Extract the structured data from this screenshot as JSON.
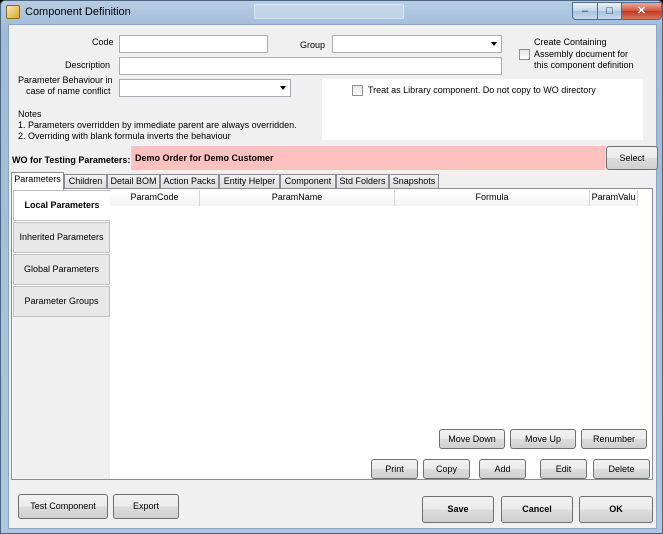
{
  "window": {
    "title": "Component Definition",
    "min_glyph": "–",
    "max_glyph": "□",
    "close_glyph": "✕"
  },
  "form": {
    "code_label": "Code",
    "code_value": "",
    "group_label": "Group",
    "group_value": "",
    "description_label": "Description",
    "description_value": "",
    "param_behaviour_label_line1": "Parameter Behaviour in",
    "param_behaviour_label_line2": "case of name conflict",
    "param_behaviour_value": "",
    "create_containing_line1": "Create Containing",
    "create_containing_line2": "Assembly document for",
    "create_containing_line3": "this component definition",
    "create_containing_checked": false,
    "library_label": "Treat as Library component. Do not copy to WO directory",
    "library_checked": false
  },
  "notes": {
    "title": "Notes",
    "line1": "1. Parameters overridden by immediate parent are always overridden.",
    "line2": "2. Overriding with blank formula inverts the behaviour"
  },
  "wo": {
    "label": "WO for Testing Parameters:",
    "value": "Demo Order for Demo Customer",
    "select_label": "Select"
  },
  "tabs": [
    "Parameters",
    "Children",
    "Detail BOM",
    "Action Packs",
    "Entity Helper",
    "Component",
    "Std Folders",
    "Snapshots"
  ],
  "side_tabs": [
    "Local Parameters",
    "Inherited Parameters",
    "Global Parameters",
    "Parameter Groups"
  ],
  "grid": {
    "columns": [
      "ParamCode",
      "ParamName",
      "Formula",
      "ParamValu"
    ]
  },
  "grid_buttons": {
    "move_down": "Move Down",
    "move_up": "Move Up",
    "renumber": "Renumber"
  },
  "action_buttons": {
    "print": "Print",
    "copy": "Copy",
    "add": "Add",
    "edit": "Edit",
    "delete": "Delete"
  },
  "footer_buttons": {
    "test_component": "Test Component",
    "export": "Export",
    "save": "Save",
    "cancel": "Cancel",
    "ok": "OK"
  }
}
